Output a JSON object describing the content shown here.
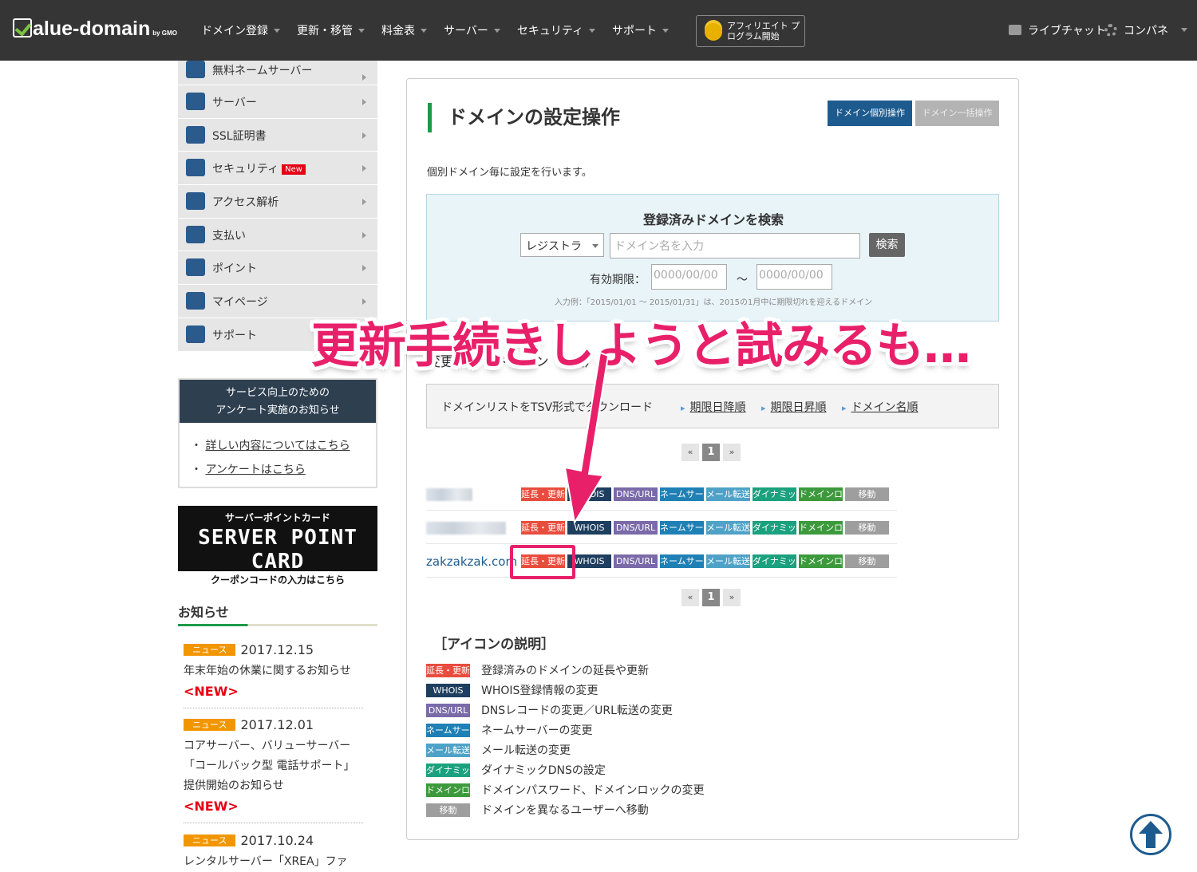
{
  "header": {
    "logo_text": "alue-domain",
    "logo_by": "by GMO",
    "nav": [
      "ドメイン登録",
      "更新・移管",
      "料金表",
      "サーバー",
      "セキュリティ",
      "サポート"
    ],
    "affiliate": "アフィリエイト プログラム開始",
    "chat": "ライブチャット",
    "control_panel": "コンパネ"
  },
  "sidebar": {
    "items": [
      {
        "label": "無料ネームサーバー",
        "icon": "server-icon"
      },
      {
        "label": "サーバー",
        "icon": "server-icon"
      },
      {
        "label": "SSL証明書",
        "icon": "lock-icon"
      },
      {
        "label": "セキュリティ",
        "icon": "shield-icon",
        "badge": "New"
      },
      {
        "label": "アクセス解析",
        "icon": "chart-icon"
      },
      {
        "label": "支払い",
        "icon": "card-icon"
      },
      {
        "label": "ポイント",
        "icon": "piggy-bank-icon"
      },
      {
        "label": "マイページ",
        "icon": "user-icon"
      },
      {
        "label": "サポート",
        "icon": "mail-icon"
      }
    ],
    "notice_title_1": "サービス向上のための",
    "notice_title_2": "アンケート実施のお知らせ",
    "notice_link_1": "詳しい内容についてはこちら",
    "notice_link_2": "アンケートはこちら",
    "card_top": "サーバーポイントカード",
    "card_main": "SERVER POINT CARD",
    "card_bottom": "クーポンコードの入力はこちら",
    "news_heading": "お知らせ",
    "news": [
      {
        "tag": "ニュース",
        "date": "2017.12.15",
        "text": "年末年始の休業に関するお知らせ",
        "new": "<NEW>"
      },
      {
        "tag": "ニュース",
        "date": "2017.12.01",
        "text": "コアサーバー、バリューサーバー「コールバック型 電話サポート」提供開始のお知らせ",
        "new": "<NEW>"
      },
      {
        "tag": "ニュース",
        "date": "2017.10.24",
        "text": "レンタルサーバー「XREA」ファ"
      }
    ]
  },
  "main": {
    "title": "ドメインの設定操作",
    "btn_individual": "ドメイン個別操作",
    "btn_bulk": "ドメイン一括操作",
    "description": "個別ドメイン毎に設定を行います。",
    "search_title": "登録済みドメインを検索",
    "registrar_select": "レジストラ",
    "domain_placeholder": "ドメイン名を入力",
    "search_btn": "検索",
    "expiry_label": "有効期限：",
    "date_placeholder": "0000/00/00",
    "tilde": "〜",
    "example": "入力例：「2015/01/01 ～ 2015/01/31」は、2015の1月中に期限切れを迎えるドメイン",
    "count_text": "変更できるドメイン（3個）",
    "download_text": "ドメインリストをTSV形式でダウンロード",
    "sort_expiry_desc": "期限日降順",
    "sort_expiry_asc": "期限日昇順",
    "sort_name": "ドメイン名順",
    "pager": {
      "prev": "«",
      "page": "1",
      "next": "»"
    },
    "domains": [
      "",
      "",
      "zakzakzak.com"
    ],
    "chips": [
      "延長・更新",
      "WHOIS",
      "DNS/URL",
      "ネームサーバー",
      "メール転送",
      "ダイナミック",
      "ドメインロック",
      "移動"
    ],
    "legend_title": "［アイコンの説明］",
    "legend": [
      {
        "chip": "延長・更新",
        "text": "登録済みのドメインの延長や更新"
      },
      {
        "chip": "WHOIS",
        "text": "WHOIS登録情報の変更"
      },
      {
        "chip": "DNS/URL",
        "text": "DNSレコードの変更／URL転送の変更"
      },
      {
        "chip": "ネームサーバー",
        "text": "ネームサーバーの変更"
      },
      {
        "chip": "メール転送",
        "text": "メール転送の変更"
      },
      {
        "chip": "ダイナミック",
        "text": "ダイナミックDNSの設定"
      },
      {
        "chip": "ドメインロック",
        "text": "ドメインパスワード、ドメインロックの変更"
      },
      {
        "chip": "移動",
        "text": "ドメインを異なるユーザーへ移動"
      }
    ]
  },
  "overlay": {
    "caption": "更新手続きしようと試みるも…",
    "accent": "#e8206a"
  }
}
